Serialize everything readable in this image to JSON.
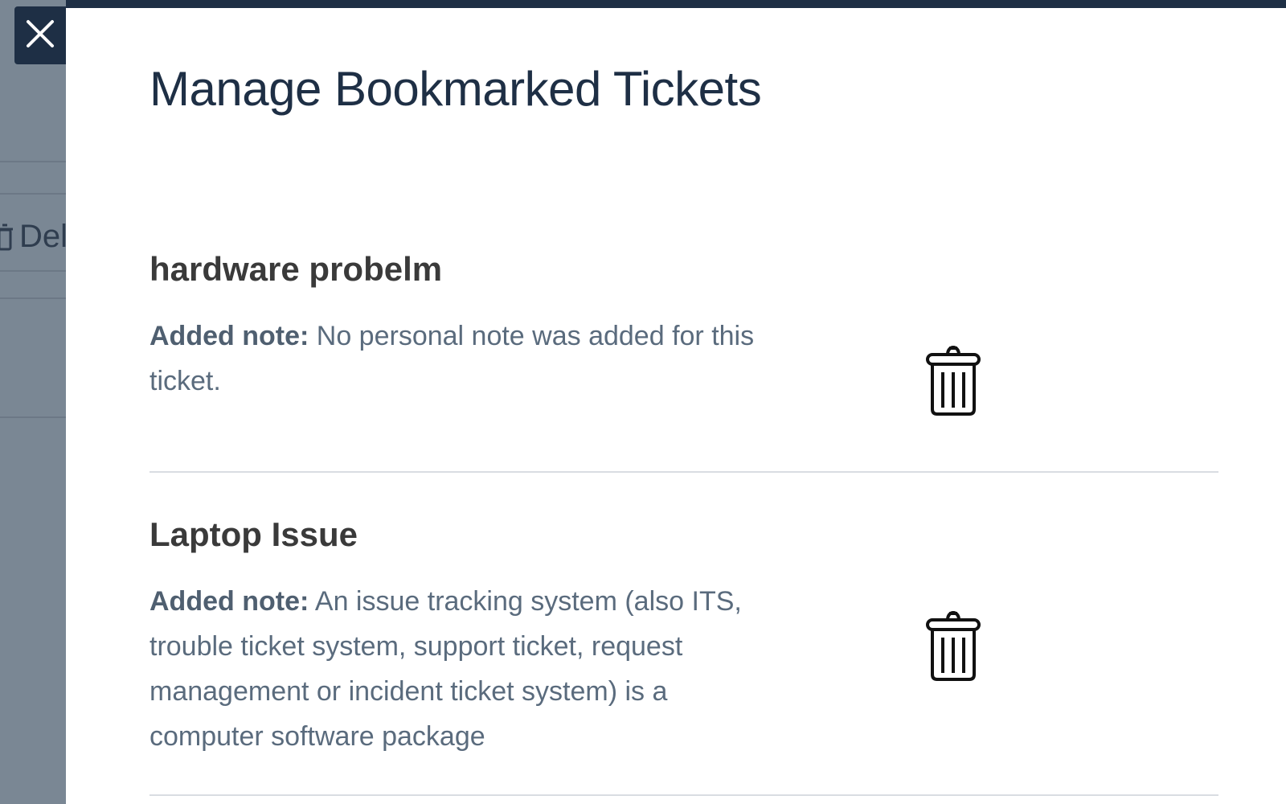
{
  "background": {
    "partial_text": "Del",
    "icon": "trash-icon"
  },
  "close_button": {
    "icon": "close-icon"
  },
  "panel": {
    "title": "Manage Bookmarked Tickets"
  },
  "tickets": [
    {
      "title": "hardware probelm",
      "note_label": "Added note:",
      "note": "No personal note was added for this ticket.",
      "delete_icon": "trash-icon"
    },
    {
      "title": "Laptop Issue",
      "note_label": "Added note:",
      "note": "An issue tracking system (also ITS, trouble ticket system, support ticket, request management or incident ticket system) is a computer software package",
      "delete_icon": "trash-icon"
    }
  ],
  "colors": {
    "header_dark": "#1e2f45",
    "backdrop": "#7a8794",
    "text_muted": "#5a6b7d"
  }
}
